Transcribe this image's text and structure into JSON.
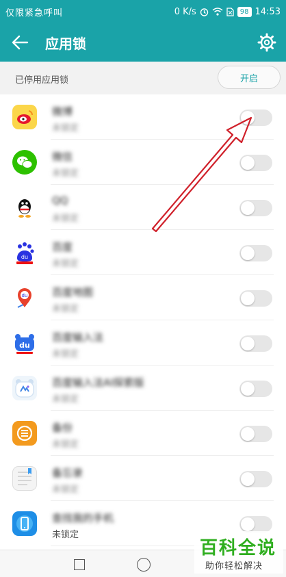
{
  "status_bar": {
    "left_text": "仅限紧急呼叫",
    "speed": "0 K/s",
    "battery": "98",
    "time": "14:53"
  },
  "app_bar": {
    "title": "应用锁",
    "back_icon": "arrow-left-icon",
    "settings_icon": "gear-icon"
  },
  "section": {
    "label": "已停用应用锁",
    "enable_button": "开启"
  },
  "apps": [
    {
      "name": "微博",
      "status": "未锁定",
      "icon": "weibo-icon",
      "enabled": false
    },
    {
      "name": "微信",
      "status": "未锁定",
      "icon": "wechat-icon",
      "enabled": false
    },
    {
      "name": "QQ",
      "status": "未锁定",
      "icon": "qq-icon",
      "enabled": false
    },
    {
      "name": "百度",
      "status": "未锁定",
      "icon": "baidu-icon",
      "enabled": false
    },
    {
      "name": "百度地图",
      "status": "未锁定",
      "icon": "baidu-map-icon",
      "enabled": false
    },
    {
      "name": "百度输入法",
      "status": "未锁定",
      "icon": "baidu-input-icon",
      "enabled": false
    },
    {
      "name": "百度输入法AI探索版",
      "status": "未锁定",
      "icon": "baidu-input-ai-icon",
      "enabled": false
    },
    {
      "name": "备份",
      "status": "未锁定",
      "icon": "backup-icon",
      "enabled": false
    },
    {
      "name": "备忘录",
      "status": "未锁定",
      "icon": "memo-icon",
      "enabled": false
    },
    {
      "name": "查找我的手机",
      "status": "未锁定",
      "icon": "find-phone-icon",
      "enabled": false
    }
  ],
  "watermark": {
    "title": "百科全说",
    "subtitle": "助你轻松解决"
  },
  "colors": {
    "accent": "#1aa3a8",
    "annotation_arrow": "#d0202a",
    "watermark_green": "#2fae1f"
  }
}
